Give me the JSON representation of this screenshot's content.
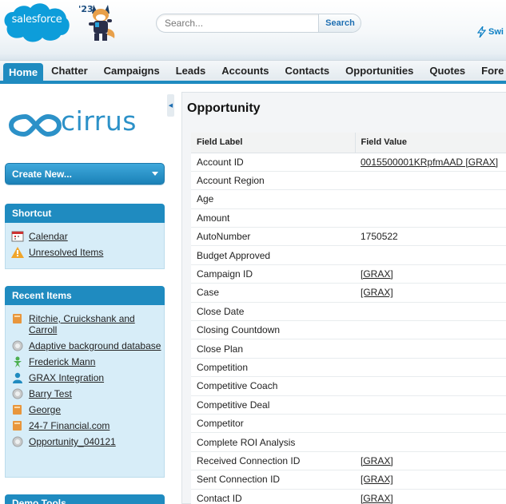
{
  "header": {
    "logo_text": "salesforce",
    "year_badge": "'23",
    "search_placeholder": "Search...",
    "search_button": "Search",
    "switch_link": "Swi"
  },
  "tabs": [
    {
      "label": "Home",
      "active": true
    },
    {
      "label": "Chatter"
    },
    {
      "label": "Campaigns"
    },
    {
      "label": "Leads"
    },
    {
      "label": "Accounts"
    },
    {
      "label": "Contacts"
    },
    {
      "label": "Opportunities"
    },
    {
      "label": "Quotes"
    },
    {
      "label": "Fore"
    }
  ],
  "sidebar": {
    "brand": "cirrus",
    "create_new": "Create New...",
    "shortcut": {
      "title": "Shortcut",
      "items": [
        {
          "label": "Calendar",
          "icon": "calendar-icon"
        },
        {
          "label": "Unresolved Items",
          "icon": "warning-icon"
        }
      ]
    },
    "recent": {
      "title": "Recent Items",
      "items": [
        {
          "label": "Ritchie, Cruickshank and Carroll",
          "icon": "account-icon"
        },
        {
          "label": "Adaptive background database",
          "icon": "opportunity-icon"
        },
        {
          "label": "Frederick Mann",
          "icon": "lead-icon"
        },
        {
          "label": "GRAX Integration",
          "icon": "contact-icon"
        },
        {
          "label": "Barry Test",
          "icon": "opportunity-icon"
        },
        {
          "label": "George",
          "icon": "account-icon"
        },
        {
          "label": "24-7 Financial.com",
          "icon": "account-icon"
        },
        {
          "label": "Opportunity_040121",
          "icon": "opportunity-icon"
        }
      ]
    },
    "demo_tools": "Demo Tools"
  },
  "main": {
    "title": "Opportunity",
    "columns": [
      "Field Label",
      "Field Value"
    ],
    "rows": [
      {
        "label": "Account ID",
        "value": "0015500001KRpfmAAD [GRAX]",
        "link": true
      },
      {
        "label": "Account Region",
        "value": ""
      },
      {
        "label": "Age",
        "value": ""
      },
      {
        "label": "Amount",
        "value": ""
      },
      {
        "label": "AutoNumber",
        "value": "1750522"
      },
      {
        "label": "Budget Approved",
        "value": ""
      },
      {
        "label": "Campaign ID",
        "value": "[GRAX]",
        "link": true
      },
      {
        "label": "Case",
        "value": "[GRAX]",
        "link": true
      },
      {
        "label": "Close Date",
        "value": ""
      },
      {
        "label": "Closing Countdown",
        "value": ""
      },
      {
        "label": "Close Plan",
        "value": ""
      },
      {
        "label": "Competition",
        "value": ""
      },
      {
        "label": "Competitive Coach",
        "value": ""
      },
      {
        "label": "Competitive Deal",
        "value": ""
      },
      {
        "label": "Competitor",
        "value": ""
      },
      {
        "label": "Complete ROI Analysis",
        "value": ""
      },
      {
        "label": "Received Connection ID",
        "value": "[GRAX]",
        "link": true
      },
      {
        "label": "Sent Connection ID",
        "value": "[GRAX]",
        "link": true
      },
      {
        "label": "Contact ID",
        "value": "[GRAX]",
        "link": true
      }
    ]
  },
  "colors": {
    "accent": "#1f8bc0",
    "sidebar_box": "#d7edf8",
    "brand_cloud": "#0d9dda"
  }
}
